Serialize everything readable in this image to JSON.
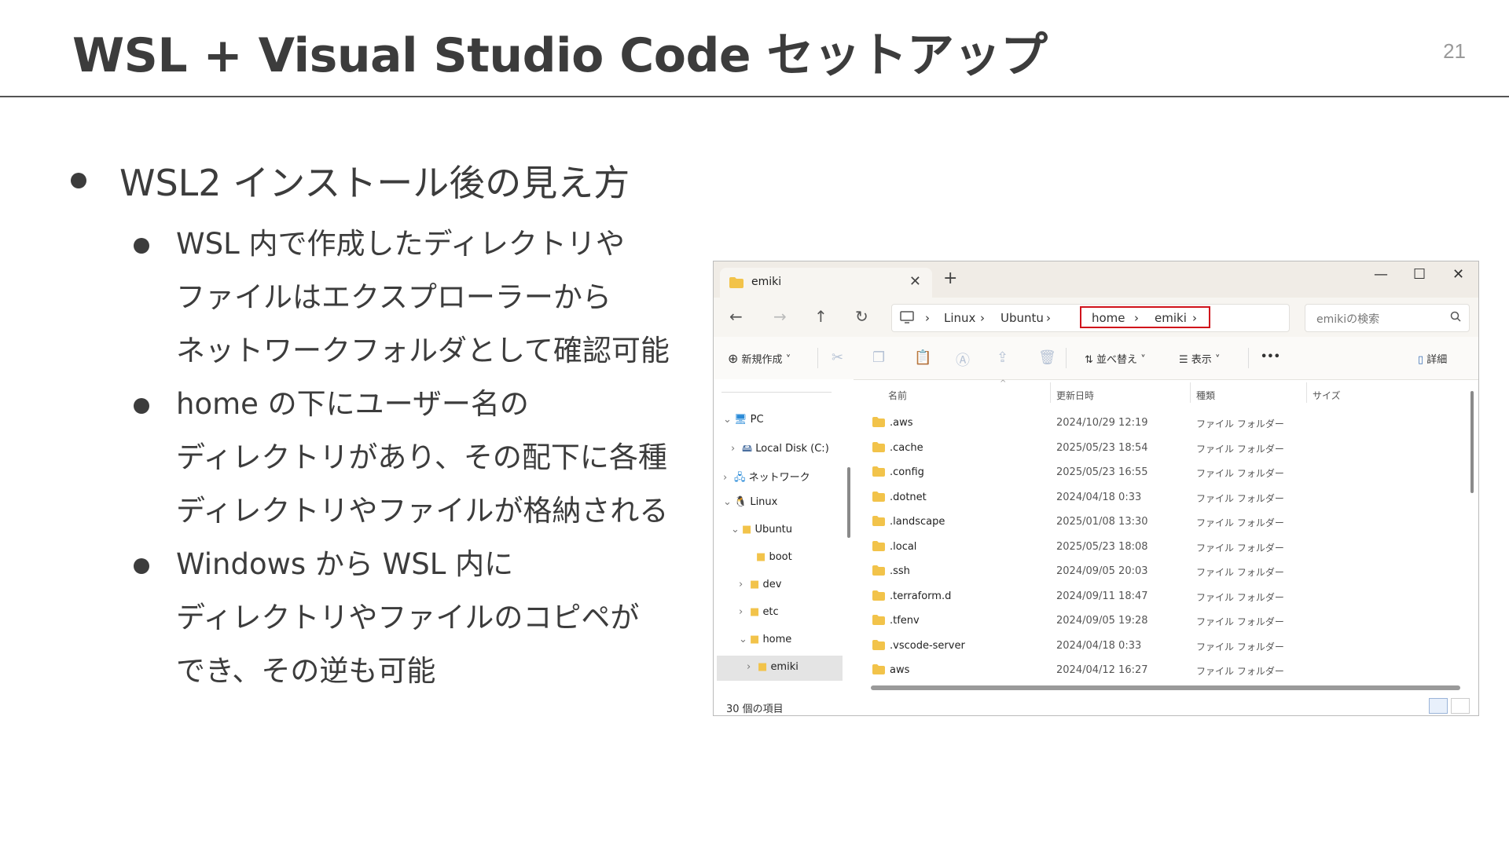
{
  "slide": {
    "title": "WSL + Visual Studio Code セットアップ",
    "page_number": "21"
  },
  "bullets": {
    "main": "WSL2 インストール後の見え方",
    "sub": [
      [
        "WSL 内で作成したディレクトリや",
        "ファイルはエクスプローラーから",
        "ネットワークフォルダとして確認可能"
      ],
      [
        "home の下にユーザー名の",
        "ディレクトリがあり、その配下に各種",
        "ディレクトリやファイルが格納される"
      ],
      [
        "Windows から WSL 内に",
        "ディレクトリやファイルのコピペが",
        "でき、その逆も可能"
      ]
    ]
  },
  "explorer": {
    "tab_title": "emiki",
    "new_tab": "+",
    "window_controls": [
      "—",
      "☐",
      "✕"
    ],
    "address": [
      "Linux",
      "Ubuntu",
      "home",
      "emiki"
    ],
    "search_placeholder": "emikiの検索",
    "toolbar": {
      "new": "新規作成",
      "sort": "並べ替え",
      "view": "表示",
      "more": "•••",
      "details": "詳細"
    },
    "nav_tree": [
      {
        "label": "PC",
        "chev": "⌄"
      },
      {
        "label": "Local Disk (C:)",
        "chev": "›"
      },
      {
        "label": "ネットワーク",
        "chev": "›"
      },
      {
        "label": "Linux",
        "chev": "⌄"
      },
      {
        "label": "Ubuntu",
        "chev": "⌄"
      },
      {
        "label": "boot",
        "chev": ""
      },
      {
        "label": "dev",
        "chev": "›"
      },
      {
        "label": "etc",
        "chev": "›"
      },
      {
        "label": "home",
        "chev": "⌄"
      },
      {
        "label": "emiki",
        "chev": "›"
      }
    ],
    "columns": [
      "名前",
      "更新日時",
      "種類",
      "サイズ"
    ],
    "files": [
      {
        "name": ".aws",
        "date": "2024/10/29 12:19",
        "kind": "ファイル フォルダー"
      },
      {
        "name": ".cache",
        "date": "2025/05/23 18:54",
        "kind": "ファイル フォルダー"
      },
      {
        "name": ".config",
        "date": "2025/05/23 16:55",
        "kind": "ファイル フォルダー"
      },
      {
        "name": ".dotnet",
        "date": "2024/04/18 0:33",
        "kind": "ファイル フォルダー"
      },
      {
        "name": ".landscape",
        "date": "2025/01/08 13:30",
        "kind": "ファイル フォルダー"
      },
      {
        "name": ".local",
        "date": "2025/05/23 18:08",
        "kind": "ファイル フォルダー"
      },
      {
        "name": ".ssh",
        "date": "2024/09/05 20:03",
        "kind": "ファイル フォルダー"
      },
      {
        "name": ".terraform.d",
        "date": "2024/09/11 18:47",
        "kind": "ファイル フォルダー"
      },
      {
        "name": ".tfenv",
        "date": "2024/09/05 19:28",
        "kind": "ファイル フォルダー"
      },
      {
        "name": ".vscode-server",
        "date": "2024/04/18 0:33",
        "kind": "ファイル フォルダー"
      },
      {
        "name": "aws",
        "date": "2024/04/12 16:27",
        "kind": "ファイル フォルダー"
      }
    ],
    "status": "30 個の項目",
    "highlight_color": "#d0121b",
    "folder_color": "#f2c34a"
  }
}
